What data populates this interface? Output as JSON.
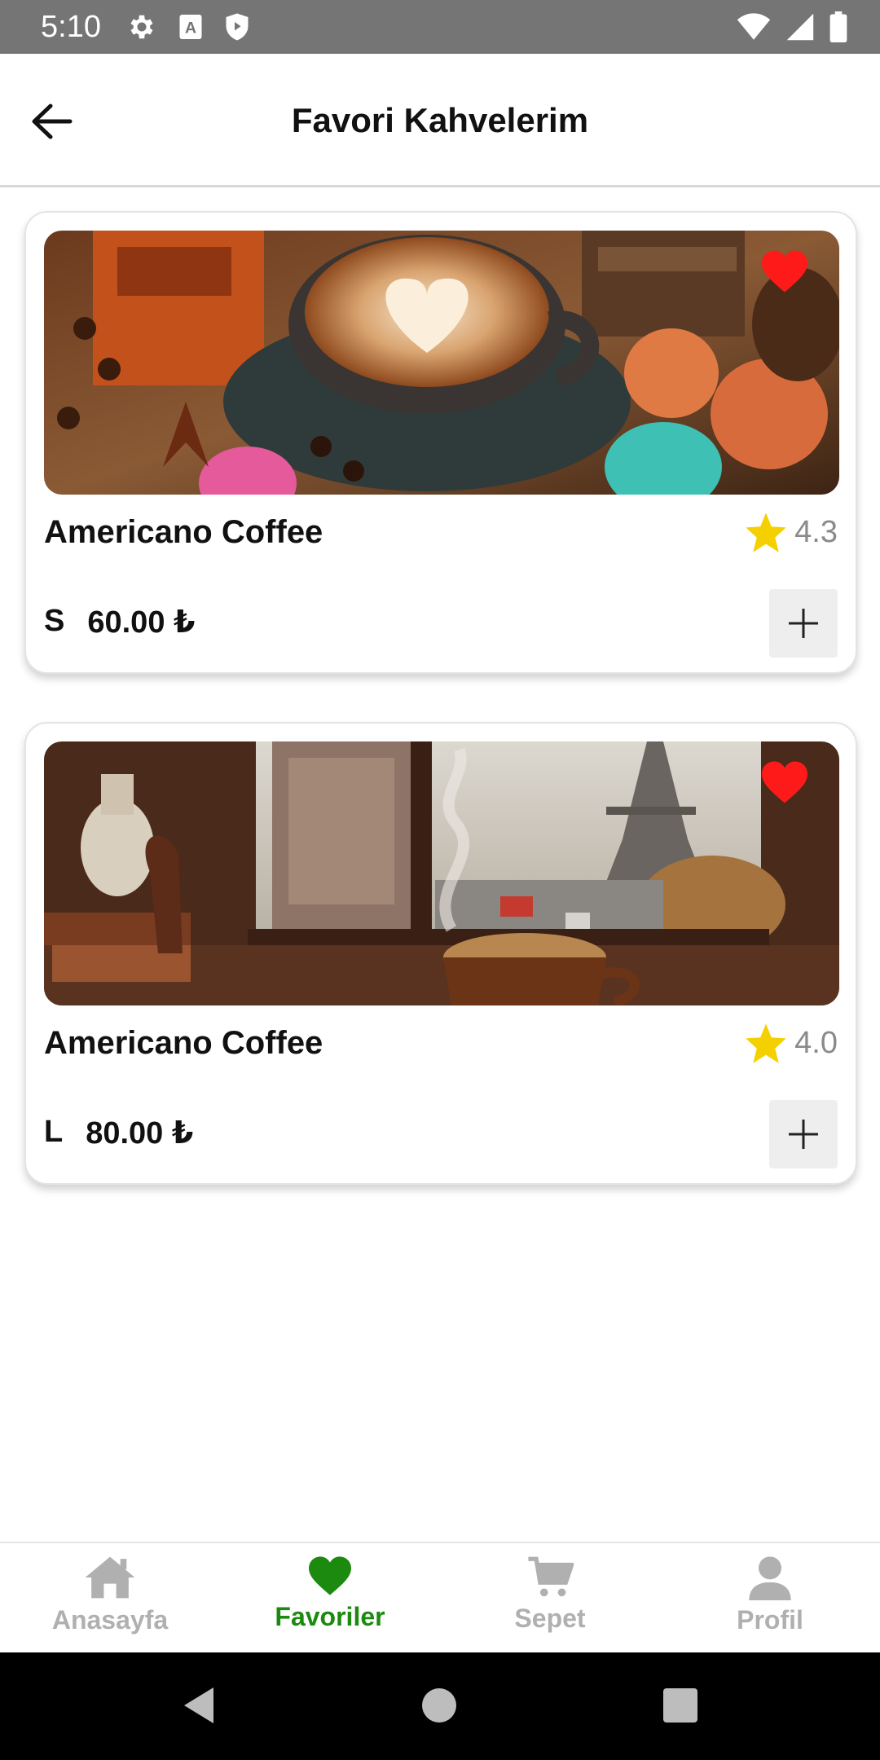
{
  "status_bar": {
    "time": "5:10",
    "left_icons": [
      "gear-icon",
      "a-badge-icon",
      "shield-icon"
    ],
    "right_icons": [
      "wifi-icon",
      "signal-icon",
      "battery-icon"
    ]
  },
  "app_bar": {
    "title": "Favori Kahvelerim",
    "back_icon": "arrow-left-icon"
  },
  "favorites": [
    {
      "name": "Americano Coffee",
      "rating": "4.3",
      "size": "S",
      "price": "60.00 ₺",
      "image": "latte art cup with macarons and coffee beans",
      "favorited": true
    },
    {
      "name": "Americano Coffee",
      "rating": "4.0",
      "size": "L",
      "price": "80.00 ₺",
      "image": "steaming coffee cup by window with Eiffel tower",
      "favorited": true
    }
  ],
  "bottom_nav": [
    {
      "label": "Anasayfa",
      "icon": "home-icon",
      "active": false
    },
    {
      "label": "Favoriler",
      "icon": "heart-icon",
      "active": true
    },
    {
      "label": "Sepet",
      "icon": "cart-icon",
      "active": false
    },
    {
      "label": "Profil",
      "icon": "person-icon",
      "active": false
    }
  ],
  "colors": {
    "accent_green": "#1c8a0f",
    "heart_red": "#ff1a1a",
    "star_yellow": "#f5d000",
    "inactive_gray": "#b0b0b0",
    "status_bar": "#757575"
  }
}
